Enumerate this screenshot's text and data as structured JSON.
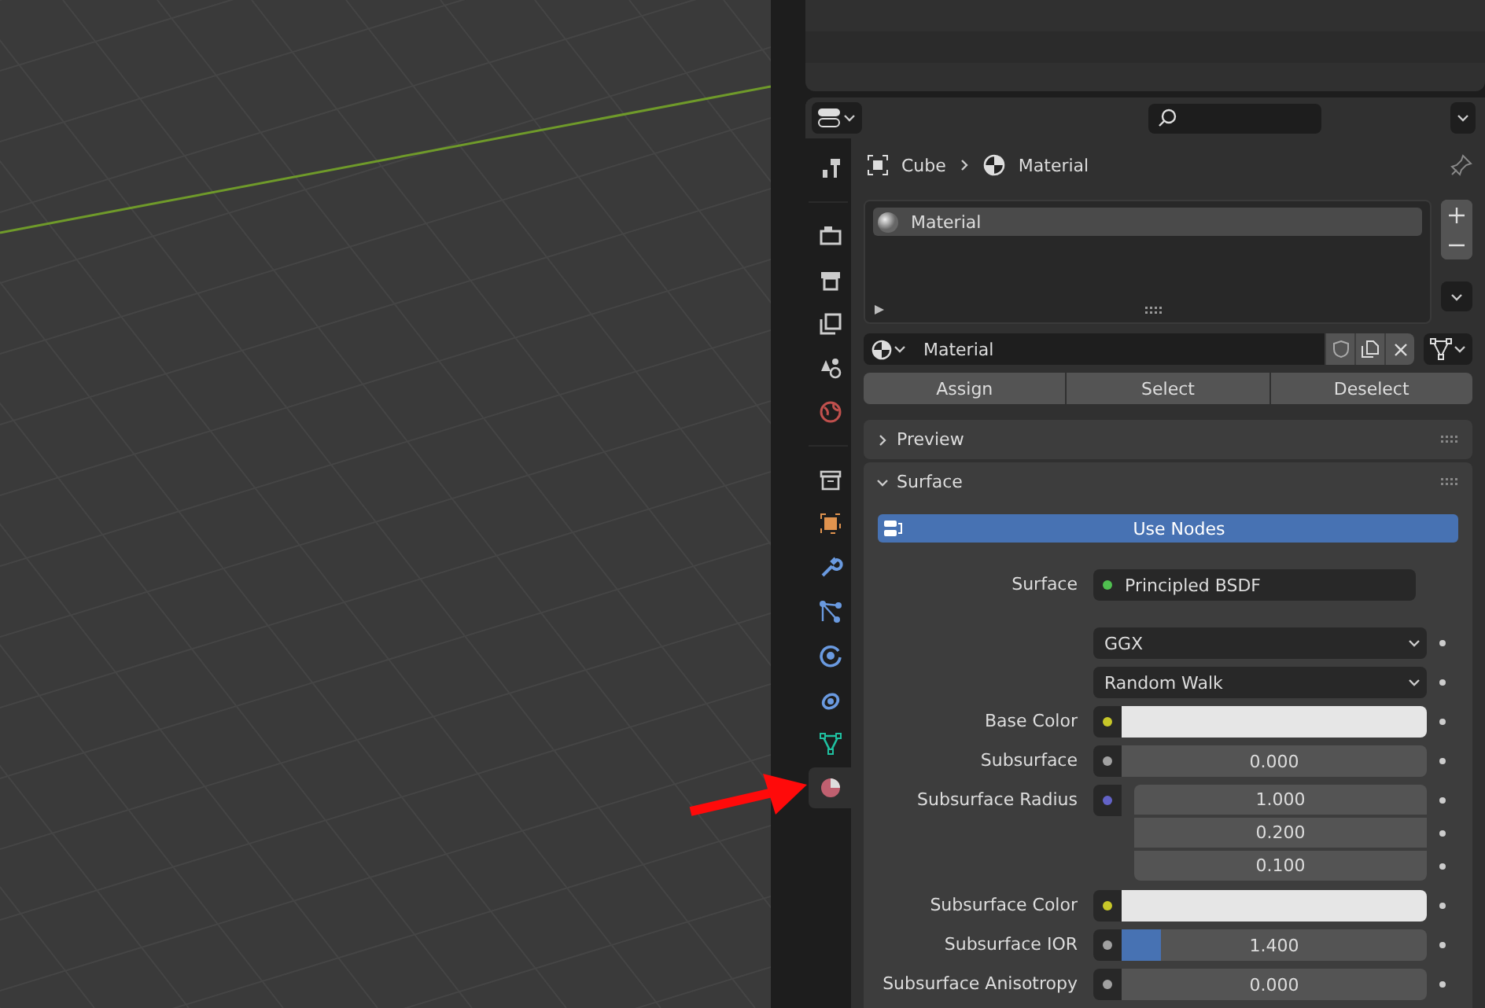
{
  "sidebar_tabs": [
    {
      "selected": false
    },
    {
      "selected": false
    },
    {
      "selected": false
    },
    {
      "selected": false
    },
    {
      "selected": false
    },
    {
      "selected": false
    },
    {
      "selected": false
    },
    {
      "selected": false
    },
    {
      "selected": false
    },
    {
      "selected": false
    },
    {
      "selected": false
    },
    {
      "selected": false
    },
    {
      "selected": false
    },
    {
      "selected": true
    }
  ],
  "breadcrumb": {
    "object": "Cube",
    "material": "Material"
  },
  "material_slots": [
    {
      "name": "Material",
      "selected": true
    }
  ],
  "material_field": {
    "value": "Material"
  },
  "slot_buttons": [
    "Assign",
    "Select",
    "Deselect"
  ],
  "panels": [
    {
      "title": "Preview",
      "expanded": false
    },
    {
      "title": "Surface",
      "expanded": true
    }
  ],
  "use_nodes": {
    "label": "Use Nodes",
    "on": true
  },
  "properties": [
    {
      "kind": "shader",
      "label": "Surface",
      "color": "#50c050",
      "value": "Principled BSDF"
    },
    {
      "kind": "enum",
      "value": "GGX"
    },
    {
      "kind": "enum",
      "value": "Random Walk"
    },
    {
      "kind": "color",
      "label": "Base Color",
      "color": "#c7c729"
    },
    {
      "kind": "value",
      "label": "Subsurface",
      "color": "#a1a1a1",
      "value": "0.000"
    },
    {
      "kind": "vector",
      "label": "Subsurface Radius",
      "color": "#6363c7",
      "values": [
        "1.000",
        "0.200",
        "0.100"
      ]
    },
    {
      "kind": "color",
      "label": "Subsurface Color",
      "color": "#c7c729"
    },
    {
      "kind": "value",
      "label": "Subsurface IOR",
      "color": "#a1a1a1",
      "value": "1.400",
      "level": 0.13
    },
    {
      "kind": "value",
      "label": "Subsurface Anisotropy",
      "color": "#a1a1a1",
      "value": "0.000"
    }
  ]
}
